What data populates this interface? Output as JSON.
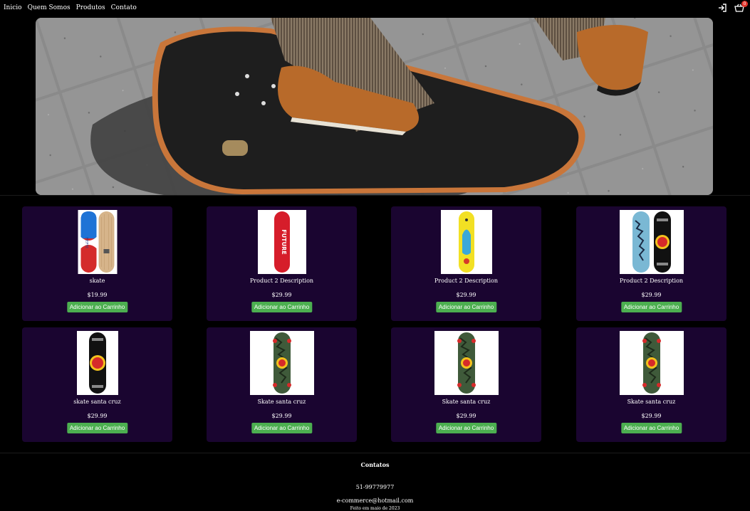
{
  "nav": {
    "links": [
      "Inicio",
      "Quem Somos",
      "Produtos",
      "Contato"
    ],
    "cart_count": "0",
    "icons": [
      "login-icon",
      "cart-icon"
    ]
  },
  "products": [
    {
      "name": "skate",
      "price": "$19.99",
      "button": "Adicionar ao Carrinho",
      "art": "pepsi"
    },
    {
      "name": "Product 2 Description",
      "price": "$29.99",
      "button": "Adicionar ao Carrinho",
      "art": "supreme"
    },
    {
      "name": "Product 2 Description",
      "price": "$29.99",
      "button": "Adicionar ao Carrinho",
      "art": "hand"
    },
    {
      "name": "Product 2 Description",
      "price": "$29.99",
      "button": "Adicionar ao Carrinho",
      "art": "santacruz-pair"
    },
    {
      "name": "skate santa cruz",
      "price": "$29.99",
      "button": "Adicionar ao Carrinho",
      "art": "santacruz-black"
    },
    {
      "name": "Skate santa cruz",
      "price": "$29.99",
      "button": "Adicionar ao Carrinho",
      "art": "santacruz-camo"
    },
    {
      "name": "Skate santa cruz",
      "price": "$29.99",
      "button": "Adicionar ao Carrinho",
      "art": "santacruz-camo"
    },
    {
      "name": "Skate santa cruz",
      "price": "$29.99",
      "button": "Adicionar ao Carrinho",
      "art": "santacruz-camo"
    }
  ],
  "footer": {
    "title": "Contatos",
    "phone": "51-99779977",
    "email": "e-commerce@hotmail.com",
    "copyright": "Feito em maio de 2023"
  },
  "colors": {
    "background": "#000000",
    "card": "#1a0530",
    "button": "#4caf50",
    "badge": "#e0342b"
  }
}
